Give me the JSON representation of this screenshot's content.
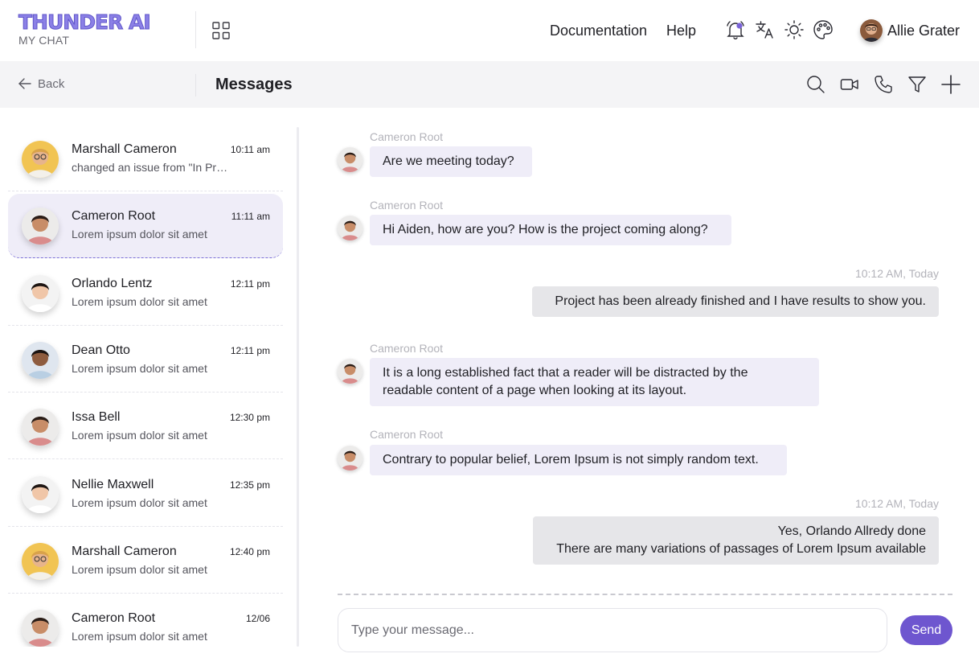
{
  "brand": {
    "name": "THUNDER AI",
    "subtitle": "MY CHAT"
  },
  "nav": {
    "documentation": "Documentation",
    "help": "Help"
  },
  "user": {
    "name": "Allie Grater"
  },
  "subheader": {
    "back_label": "Back",
    "title": "Messages"
  },
  "icons": {
    "apps": "grid-icon",
    "notifications": "bell-icon",
    "translate": "translate-icon",
    "theme": "sun-icon",
    "palette": "palette-icon",
    "search": "search-icon",
    "video": "video-icon",
    "call": "phone-icon",
    "filter": "filter-icon",
    "add": "plus-icon",
    "back": "arrow-left-icon"
  },
  "colors": {
    "accent": "#6e56cf",
    "active_row": "#efedf8",
    "incoming_bubble": "#efedf8",
    "outgoing_bubble": "#e6e6e9"
  },
  "conversations": [
    {
      "name": "Marshall Cameron",
      "time": "10:11 am",
      "preview": "changed an issue from \"In Progress\""
    },
    {
      "name": "Cameron Root",
      "time": "11:11 am",
      "preview": "Lorem ipsum dolor sit amet"
    },
    {
      "name": "Orlando Lentz",
      "time": "12:11 pm",
      "preview": "Lorem ipsum dolor sit amet"
    },
    {
      "name": "Dean Otto",
      "time": "12:11 pm",
      "preview": "Lorem ipsum dolor sit amet"
    },
    {
      "name": "Issa Bell",
      "time": "12:30 pm",
      "preview": "Lorem ipsum dolor sit amet"
    },
    {
      "name": "Nellie Maxwell",
      "time": "12:35 pm",
      "preview": "Lorem ipsum dolor sit amet"
    },
    {
      "name": "Marshall Cameron",
      "time": "12:40 pm",
      "preview": "Lorem ipsum dolor sit amet"
    },
    {
      "name": "Cameron Root",
      "time": "12/06",
      "preview": "Lorem ipsum dolor sit amet"
    }
  ],
  "messages": [
    {
      "direction": "in",
      "sender": "Cameron Root",
      "lines": [
        "Are we meeting today?"
      ]
    },
    {
      "direction": "in",
      "sender": "Cameron Root",
      "lines": [
        "Hi Aiden, how are you? How is the project coming along?"
      ]
    },
    {
      "direction": "out",
      "time": "10:12 AM, Today",
      "lines": [
        "Project has been already finished and I have results to show you."
      ]
    },
    {
      "direction": "in",
      "sender": "Cameron Root",
      "lines": [
        "It is a long established fact that a reader will be distracted by the",
        "readable content of a page when looking at its layout."
      ]
    },
    {
      "direction": "in",
      "sender": "Cameron Root",
      "lines": [
        "Contrary to popular belief, Lorem Ipsum is not simply random text."
      ]
    },
    {
      "direction": "out",
      "time": "10:12 AM, Today",
      "lines": [
        "Yes, Orlando Allredy done",
        "There are many variations of passages of Lorem Ipsum available"
      ]
    }
  ],
  "composer": {
    "placeholder": "Type your message...",
    "value": "",
    "send_label": "Send"
  }
}
